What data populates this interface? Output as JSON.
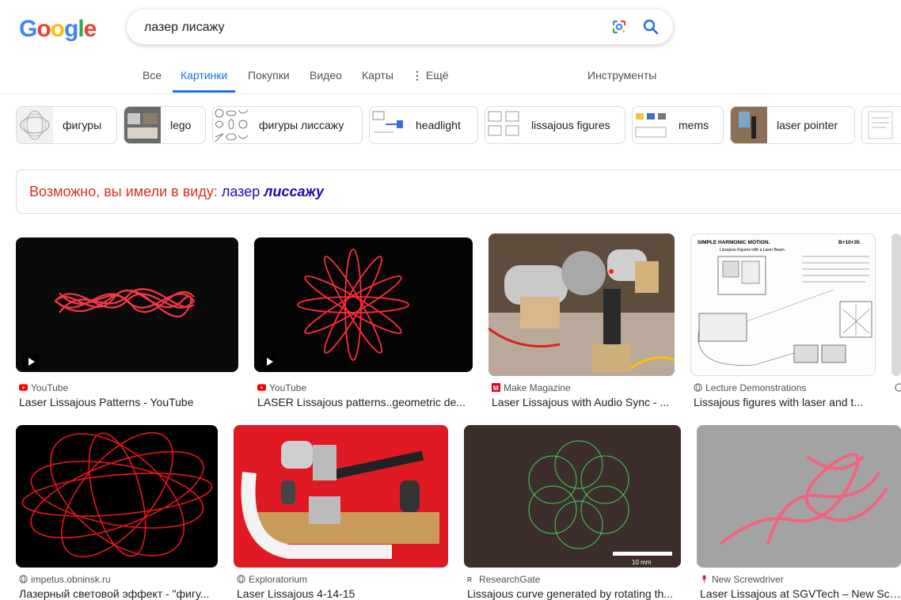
{
  "brand": {
    "letters": [
      "G",
      "o",
      "o",
      "g",
      "l",
      "e"
    ],
    "colors": [
      "#4285F4",
      "#EA4335",
      "#FBBC05",
      "#4285F4",
      "#34A853",
      "#EA4335"
    ]
  },
  "search": {
    "value": "лазер лисажу"
  },
  "tabs": [
    {
      "label": "Все"
    },
    {
      "label": "Картинки"
    },
    {
      "label": "Покупки"
    },
    {
      "label": "Видео"
    },
    {
      "label": "Карты"
    },
    {
      "label": "Ещё"
    },
    {
      "label": "Инструменты"
    }
  ],
  "chips": [
    {
      "label": "фигуры"
    },
    {
      "label": "lego"
    },
    {
      "label": "фигуры лиссажу"
    },
    {
      "label": "headlight"
    },
    {
      "label": "lissajous figures"
    },
    {
      "label": "mems"
    },
    {
      "label": "laser pointer"
    },
    {
      "label": ""
    }
  ],
  "did_you_mean": {
    "prefix": "Возможно, вы имели в виду:",
    "plain": "лазер",
    "bold": "лиссажу"
  },
  "results_row1": [
    {
      "source": "YouTube",
      "title": "Laser Lissajous Patterns - YouTube",
      "icon": "youtube-icon",
      "video": true
    },
    {
      "source": "YouTube",
      "title": "LASER Lissajous patterns..geometric de...",
      "icon": "youtube-icon",
      "video": true
    },
    {
      "source": "Make Magazine",
      "title": "Laser Lissajous with Audio Sync - ...",
      "icon": "make-icon",
      "video": false
    },
    {
      "source": "Lecture Demonstrations",
      "title": "Lissajous figures with laser and t...",
      "icon": "globe-icon",
      "video": false
    },
    {
      "source": "",
      "title": "",
      "icon": "globe-icon",
      "video": false
    }
  ],
  "results_row2": [
    {
      "source": "impetus.obninsk.ru",
      "title": "Лазерный световой эффект - \"фигу...",
      "icon": "globe-icon"
    },
    {
      "source": "Exploratorium",
      "title": "Laser Lissajous 4-14-15",
      "icon": "globe-icon"
    },
    {
      "source": "ResearchGate",
      "title": "Lissajous curve generated by rotating th...",
      "icon": "researchgate-icon"
    },
    {
      "source": "New Screwdriver",
      "title": "Laser Lissajous at SGVTech – New Scr...",
      "icon": "screwdriver-icon"
    }
  ],
  "diagram_texts": {
    "harmonic": "SIMPLE HARMONIC MOTION.",
    "code": "B+10+35",
    "subtitle": "Lissajous Figures with a Laser Beam.",
    "scale": "10 mm"
  }
}
